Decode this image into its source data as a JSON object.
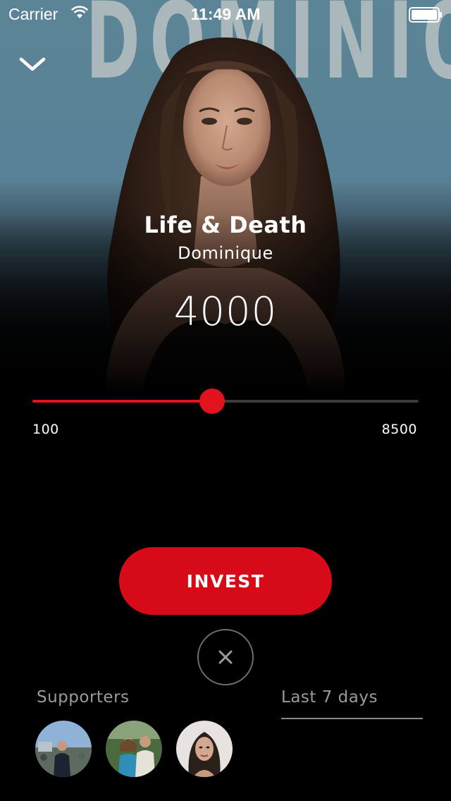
{
  "status_bar": {
    "carrier": "Carrier",
    "time": "11:49 AM"
  },
  "hero": {
    "banner_text": "DOMINIQUE"
  },
  "track": {
    "title": "Life & Death",
    "artist": "Dominique"
  },
  "investment": {
    "amount": "4000",
    "min_label": "100",
    "max_label": "8500",
    "level_fraction": 0.465
  },
  "actions": {
    "invest_label": "INVEST"
  },
  "supporters": {
    "label": "Supporters",
    "period": "Last 7 days"
  },
  "colors": {
    "accent": "#d70b17",
    "slider_fill": "#e1131c",
    "muted_text": "#9a9a9a",
    "background": "#000000",
    "sky": "#5b8497"
  }
}
